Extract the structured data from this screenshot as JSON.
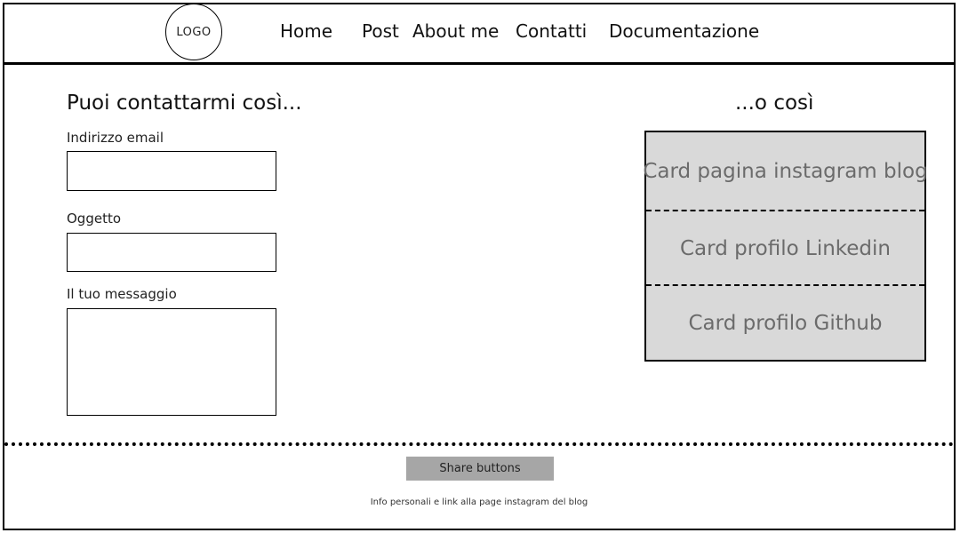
{
  "header": {
    "logo_text": "LOGO",
    "nav": [
      "Home",
      "Post",
      "About me",
      "Contatti",
      "Documentazione"
    ]
  },
  "contact_form": {
    "title": "Puoi contattarmi così...",
    "email_label": "Indirizzo email",
    "email_value": "",
    "subject_label": "Oggetto",
    "subject_value": "",
    "message_label": "Il tuo messaggio",
    "message_value": ""
  },
  "social": {
    "title": "...o così",
    "cards": [
      "Card pagina instagram blog",
      "Card profilo Linkedin",
      "Card profilo Github"
    ]
  },
  "footer": {
    "share_label": "Share buttons",
    "info": "Info personali e link alla page instagram del blog"
  },
  "colors": {
    "card_bg": "#d9d9d9",
    "card_text": "#6b6b6b",
    "share_bg": "#a6a6a6"
  }
}
